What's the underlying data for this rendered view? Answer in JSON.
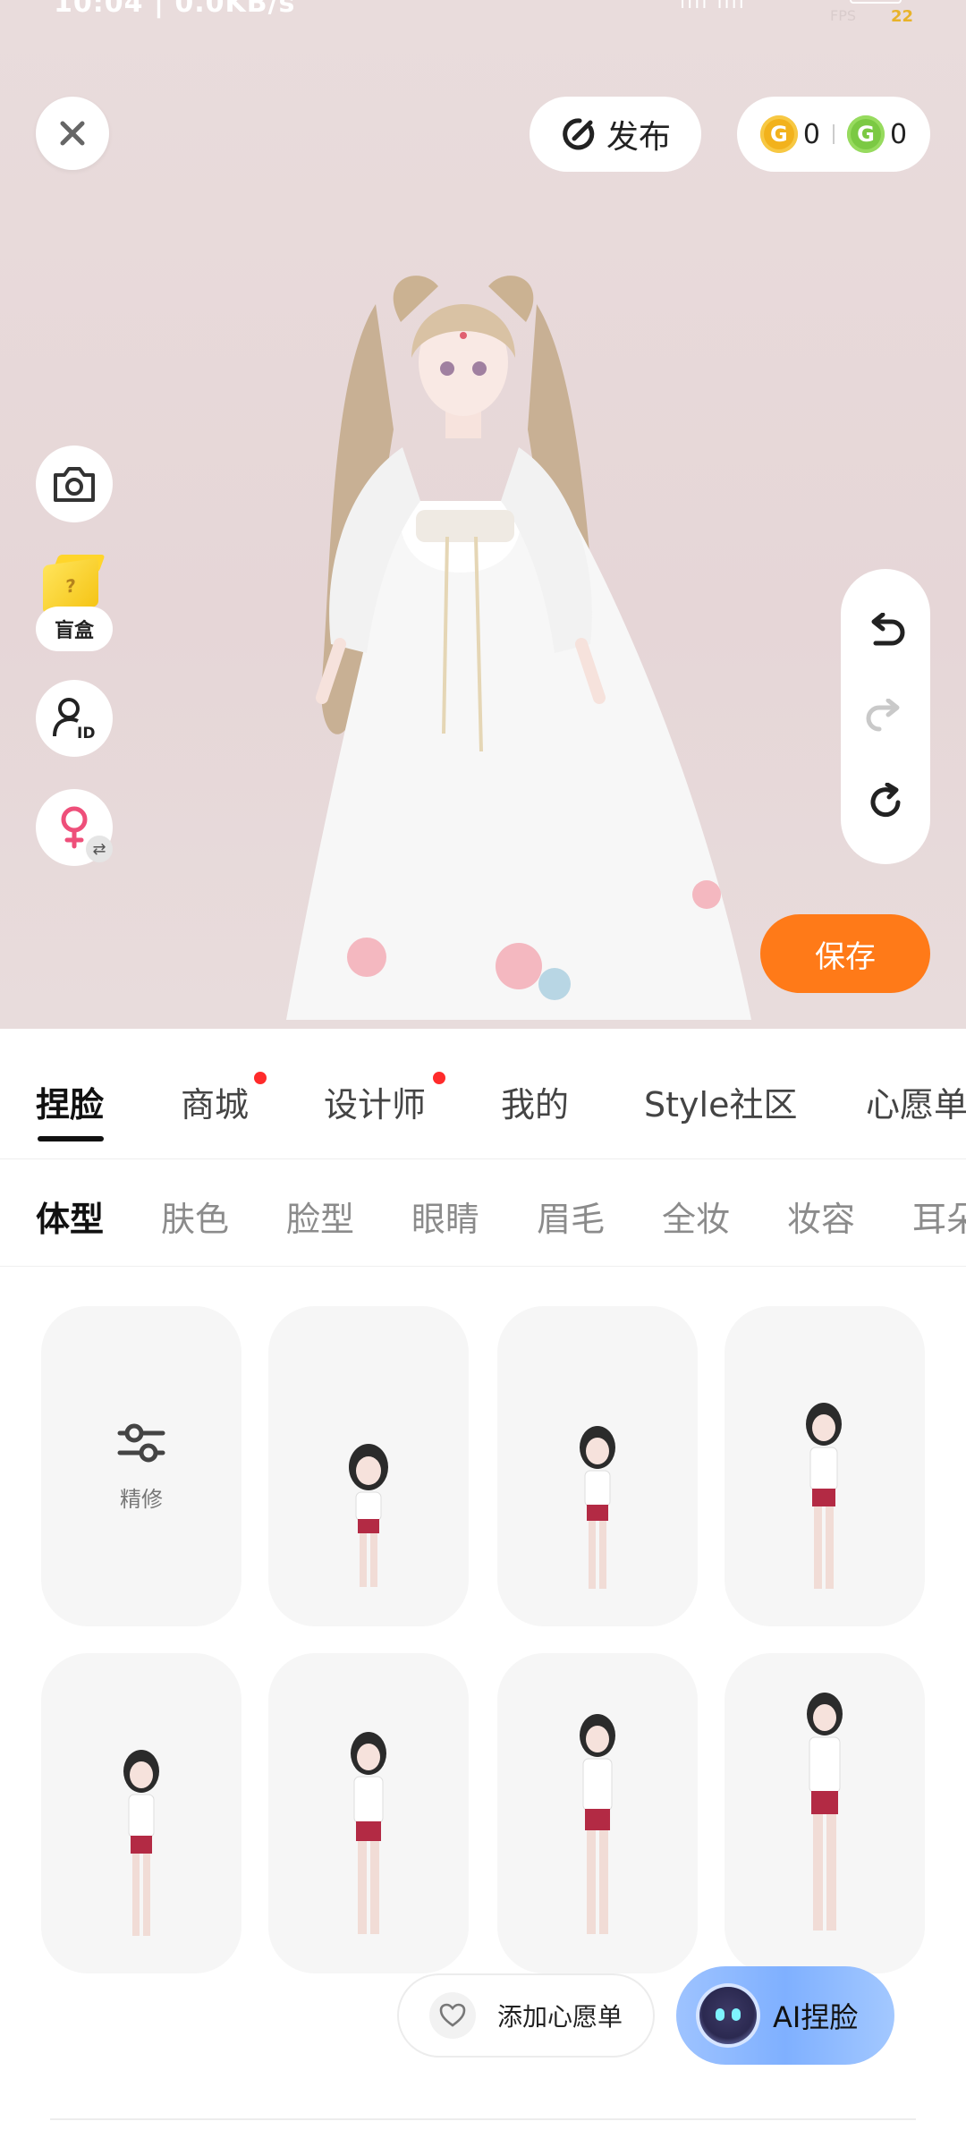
{
  "status_bar": {
    "time": "10:04 | 0.0KB/s",
    "fps_label": "FPS",
    "fps_value": "22"
  },
  "header": {
    "publish_label": "发布",
    "coins": {
      "gold": "0",
      "green": "0"
    }
  },
  "side": {
    "blindbox_label": "盲盒"
  },
  "save_label": "保存",
  "main_tabs": [
    {
      "label": "捏脸",
      "active": true
    },
    {
      "label": "商城",
      "dot": true
    },
    {
      "label": "设计师",
      "dot": true
    },
    {
      "label": "我的"
    },
    {
      "label": "Style社区"
    },
    {
      "label": "心愿单"
    }
  ],
  "sub_tabs": [
    {
      "label": "体型",
      "active": true
    },
    {
      "label": "肤色"
    },
    {
      "label": "脸型"
    },
    {
      "label": "眼睛"
    },
    {
      "label": "眉毛"
    },
    {
      "label": "全妆"
    },
    {
      "label": "妆容"
    },
    {
      "label": "耳朵"
    }
  ],
  "grid": {
    "refine_label": "精修"
  },
  "wishlist_label": "添加心愿单",
  "ai_label": "AI捏脸",
  "colors": {
    "accent": "#ff7a18",
    "dot": "#ff2b2b",
    "ai": "#8ab8ff"
  }
}
